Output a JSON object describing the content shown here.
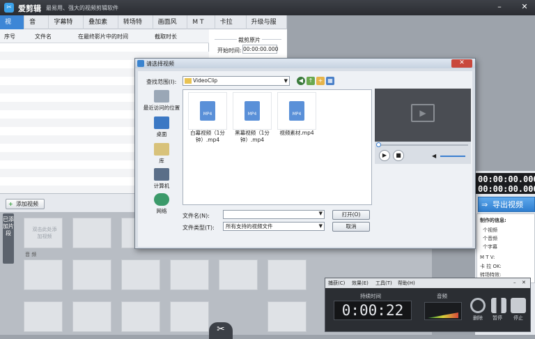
{
  "app": {
    "title": "爱剪辑",
    "slogan": "最易用、强大的视频剪辑软件",
    "icon": "scissors-logo-icon"
  },
  "tabs": [
    "视 频",
    "音 频",
    "字幕特效",
    "叠加素材",
    "转场特效",
    "画面风格",
    "M T V",
    "卡拉OK",
    "升级与服务"
  ],
  "file_list": {
    "columns": [
      "序号",
      "文件名",
      "在最终影片中的时间",
      "截取时长"
    ]
  },
  "trim": {
    "title": "裁剪原片",
    "start_label": "开始时间:",
    "start_value": "00:00:00.000"
  },
  "add_video_label": "添加视频",
  "added_clips_tab": "已添加片段",
  "timeline": {
    "placeholder_text": "双击此处添加视频",
    "audio_track_label": "音 频"
  },
  "right_panel": {
    "time1": "00:00:00.000",
    "time2": "00:00:00.000",
    "export_label": "导出视频",
    "info_title": "制作的信息:",
    "info_lines": [
      "个视频",
      "个音频",
      "个字幕",
      "M T V:",
      "卡 拉 OK:",
      "转场特效:"
    ]
  },
  "dialog": {
    "title": "请选择视频",
    "look_in_label": "查找范围(I):",
    "look_in_value": "VideoClip",
    "places": [
      "最近访问的位置",
      "桌面",
      "库",
      "计算机",
      "网络"
    ],
    "files": [
      {
        "name": "白幕视频（1分钟）.mp4",
        "type": "MP4"
      },
      {
        "name": "黑幕视频（1分钟）.mp4",
        "type": "MP4"
      },
      {
        "name": "视频素材.mp4",
        "type": "MP4"
      }
    ],
    "filename_label": "文件名(N):",
    "filename_value": "",
    "filetype_label": "文件类型(T):",
    "filetype_value": "所有支持的视频文件",
    "open_label": "打开(O)",
    "cancel_label": "取消"
  },
  "recorder": {
    "menu": [
      "捕获(C)",
      "效果(E)",
      "工具(T)",
      "帮助(H)"
    ],
    "duration_label": "持续时间",
    "timer": "0:00:22",
    "audio_label": "音频",
    "buttons": [
      "删除",
      "暂停",
      "停止"
    ]
  }
}
